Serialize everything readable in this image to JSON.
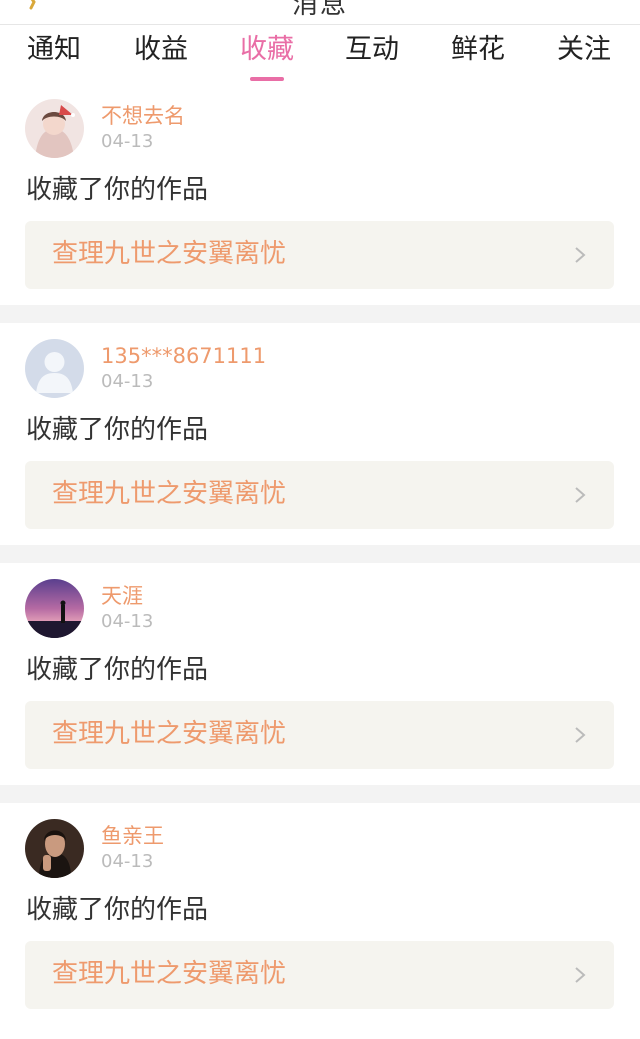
{
  "header": {
    "title": "消息",
    "back_icon": "back-arrow-icon"
  },
  "tabs": [
    {
      "label": "通知",
      "active": false
    },
    {
      "label": "收益",
      "active": false
    },
    {
      "label": "收藏",
      "active": true
    },
    {
      "label": "互动",
      "active": false
    },
    {
      "label": "鲜花",
      "active": false
    },
    {
      "label": "关注",
      "active": false
    }
  ],
  "colors": {
    "accent": "#e96ea6",
    "username": "#ee9a6d",
    "work_link_bg": "#f5f4ef",
    "separator": "#f3f3f3"
  },
  "feed": [
    {
      "username": "不想去名",
      "time": "04-13",
      "action": "收藏了你的作品",
      "work_title": "查理九世之安翼离忧"
    },
    {
      "username": "135***8671111",
      "time": "04-13",
      "action": "收藏了你的作品",
      "work_title": "查理九世之安翼离忧"
    },
    {
      "username": "天涯",
      "time": "04-13",
      "action": "收藏了你的作品",
      "work_title": "查理九世之安翼离忧"
    },
    {
      "username": "鱼亲王",
      "time": "04-13",
      "action": "收藏了你的作品",
      "work_title": "查理九世之安翼离忧"
    }
  ]
}
